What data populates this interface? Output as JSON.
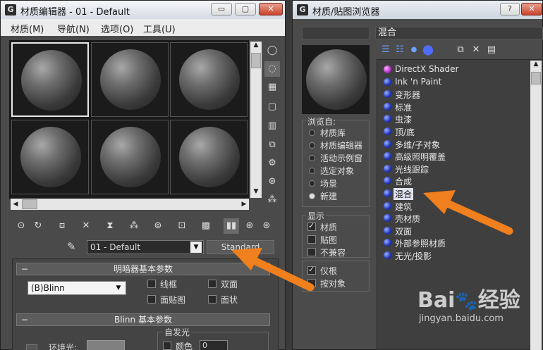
{
  "left_window": {
    "title": "材质编辑器 - 01 - Default",
    "title_buttons": [
      "▭",
      "▢",
      "✕"
    ],
    "menu": [
      "材质(M)",
      "导航(N)",
      "选项(O)",
      "工具(U)"
    ],
    "material_name": "01 - Default",
    "material_type_button": "Standard",
    "shader_rollout": {
      "title": "明暗器基本参数",
      "shader": "(B)Blinn",
      "options": [
        "线框",
        "双面",
        "面贴图",
        "面状"
      ]
    },
    "blinn_rollout": {
      "title": "Blinn 基本参数",
      "self_illum_group": "自发光",
      "color_label": "颜色",
      "color_value": "0",
      "ambient_label": "环境光:"
    }
  },
  "right_window": {
    "title": "材质/贴图浏览器",
    "title_buttons": [
      "?",
      "✕"
    ],
    "search_value": "混合",
    "browse_from_title": "浏览自:",
    "browse_from": [
      "材质库",
      "材质编辑器",
      "活动示例窗",
      "选定对象",
      "场景",
      "新建"
    ],
    "browse_selected": "新建",
    "show_title": "显示",
    "show_options": [
      {
        "label": "材质",
        "checked": true
      },
      {
        "label": "贴图",
        "checked": false
      },
      {
        "label": "不兼容",
        "checked": false
      }
    ],
    "root_options": [
      {
        "label": "仅根",
        "checked": true
      },
      {
        "label": "按对象",
        "checked": false
      }
    ],
    "materials": [
      {
        "name": "DirectX Shader",
        "color": "magenta"
      },
      {
        "name": "Ink 'n Paint",
        "color": "blue"
      },
      {
        "name": "变形器",
        "color": "blue"
      },
      {
        "name": "标准",
        "color": "blue"
      },
      {
        "name": "虫漆",
        "color": "blue"
      },
      {
        "name": "顶/底",
        "color": "blue"
      },
      {
        "name": "多维/子对象",
        "color": "blue"
      },
      {
        "name": "高级照明覆盖",
        "color": "blue"
      },
      {
        "name": "光线跟踪",
        "color": "blue"
      },
      {
        "name": "合成",
        "color": "blue"
      },
      {
        "name": "混合",
        "color": "blue",
        "selected": true
      },
      {
        "name": "建筑",
        "color": "blue"
      },
      {
        "name": "壳材质",
        "color": "blue"
      },
      {
        "name": "双面",
        "color": "blue"
      },
      {
        "name": "外部参照材质",
        "color": "blue"
      },
      {
        "name": "无光/投影",
        "color": "blue"
      }
    ]
  },
  "watermark": {
    "brand": "Bai",
    "brand_suffix": "经验",
    "url": "jingyan.baidu.com"
  },
  "colors": {
    "arrow": "#f07f1e",
    "panel": "#4a4a4a",
    "selection": "#dfe3f0"
  }
}
